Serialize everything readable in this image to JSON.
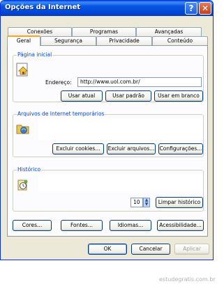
{
  "window": {
    "title": "Opções da Internet"
  },
  "titlebar": {
    "help": "?",
    "close": "✕"
  },
  "tabs": {
    "back_row": [
      "Conexões",
      "Programas",
      "Avançadas"
    ],
    "front_row": [
      "Geral",
      "Segurança",
      "Privacidade",
      "Conteúdo"
    ]
  },
  "home": {
    "label": "Página inicial",
    "address_label": "Endereço:",
    "address_value": "http://www.uol.com.br/",
    "use_current": "Usar atual",
    "use_default": "Usar padrão",
    "use_blank": "Usar em branco"
  },
  "temp_files": {
    "label": "Arquivos de Internet temporários",
    "delete_cookies": "Excluir cookies...",
    "delete_files": "Excluir arquivos...",
    "settings": "Configurações..."
  },
  "history": {
    "label": "Histórico",
    "days_value": "10",
    "clear": "Limpar histórico"
  },
  "bottom_row": {
    "colors": "Cores...",
    "fonts": "Fontes...",
    "languages": "Idiomas...",
    "accessibility": "Acessibilidade..."
  },
  "dialog": {
    "ok": "OK",
    "cancel": "Cancelar",
    "apply": "Aplicar"
  },
  "watermark": "estudegratis.com.br"
}
